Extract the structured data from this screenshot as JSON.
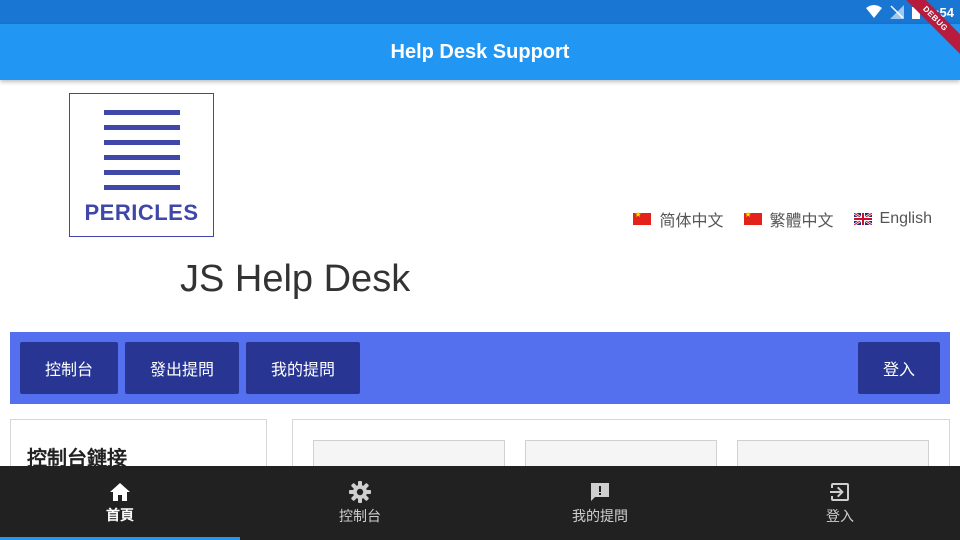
{
  "status_bar": {
    "time": "4:54"
  },
  "debug_banner": "DEBUG",
  "app_bar": {
    "title": "Help Desk Support"
  },
  "logo": {
    "text": "PERICLES"
  },
  "languages": [
    {
      "label": "简体中文",
      "flag": "cn-flag-icon"
    },
    {
      "label": "繁體中文",
      "flag": "cn-flag-icon"
    },
    {
      "label": "English",
      "flag": "uk-flag-icon"
    }
  ],
  "main_heading": "JS Help Desk",
  "nav": {
    "dashboard": "控制台",
    "new_ticket": "發出提問",
    "my_tickets": "我的提問",
    "login": "登入"
  },
  "left_panel": {
    "title": "控制台鏈接"
  },
  "bottom_nav": [
    {
      "label": "首頁",
      "icon": "home-icon",
      "active": true
    },
    {
      "label": "控制台",
      "icon": "gear-icon",
      "active": false
    },
    {
      "label": "我的提問",
      "icon": "feedback-icon",
      "active": false
    },
    {
      "label": "登入",
      "icon": "login-icon",
      "active": false
    }
  ],
  "colors": {
    "status_bar": "#1976d2",
    "app_bar": "#2196f3",
    "nav_bar": "#5470ef",
    "nav_button": "#283593",
    "logo": "#3f48a8",
    "bottom_nav": "#212121"
  }
}
